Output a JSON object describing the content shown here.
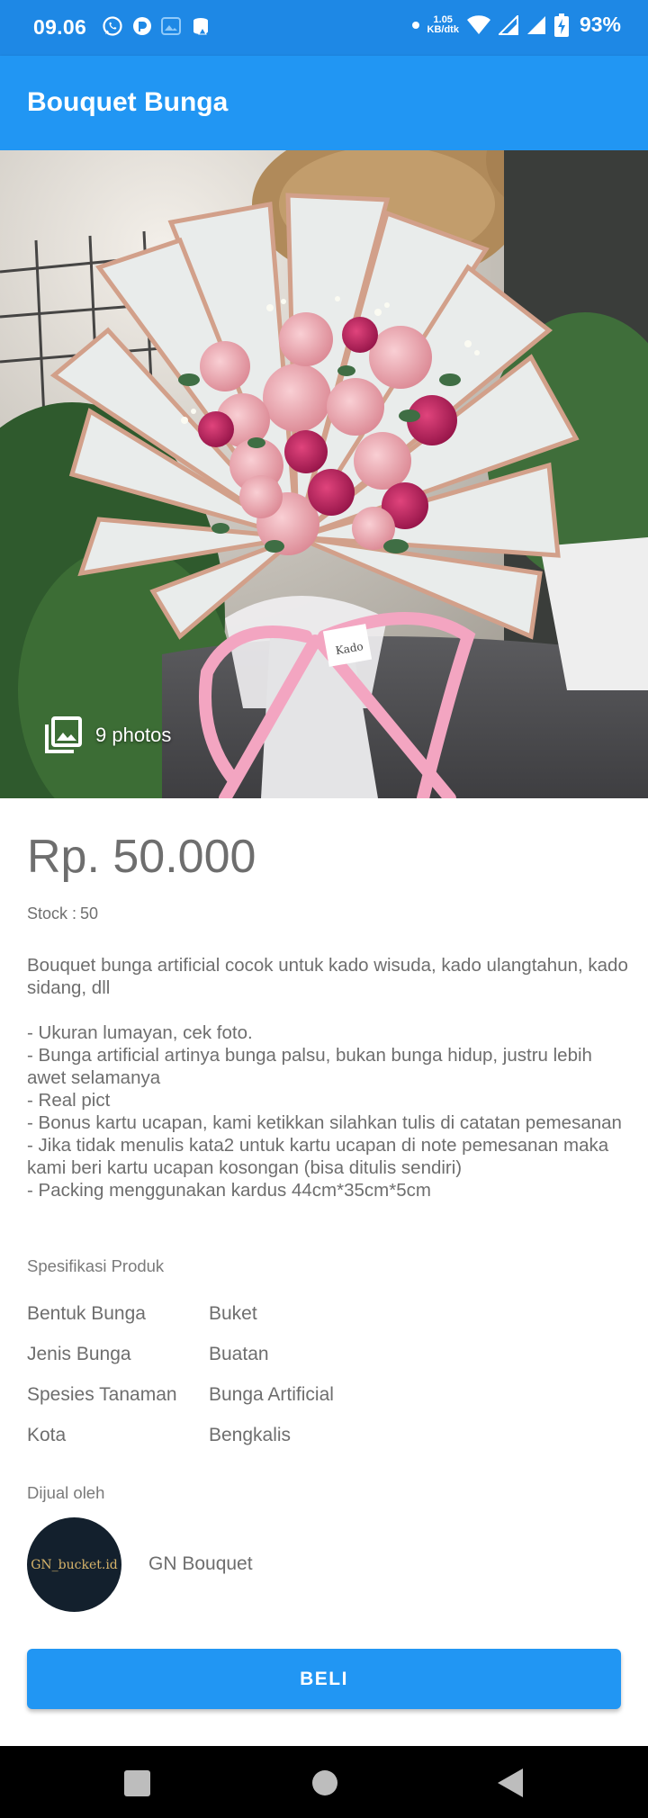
{
  "status_bar": {
    "time": "09.06",
    "net_speed_value": "1.05",
    "net_speed_unit": "KB/dtk",
    "battery": "93%",
    "icons": [
      "whatsapp-icon",
      "app-icon",
      "gallery-icon",
      "cloud-icon",
      "dot-icon",
      "wifi-icon",
      "signal-icon",
      "signal-icon",
      "battery-charging-icon"
    ]
  },
  "app_bar": {
    "title": "Bouquet Bunga"
  },
  "hero": {
    "photos_label": "9 photos",
    "icon": "photo-library-icon"
  },
  "product": {
    "price": "Rp. 50.000",
    "stock_label": "Stock :",
    "stock_value": "50",
    "description": "Bouquet bunga artificial cocok untuk kado wisuda, kado ulangtahun, kado sidang, dll\n\n- Ukuran lumayan, cek foto.\n- Bunga artificial artinya bunga palsu, bukan bunga hidup, justru lebih awet selamanya\n- Real pict\n- Bonus kartu ucapan, kami ketikkan silahkan tulis di catatan pemesanan\n- Jika tidak menulis kata2 untuk kartu ucapan di note pemesanan maka kami beri kartu ucapan kosongan (bisa ditulis sendiri)\n- Packing menggunakan kardus 44cm*35cm*5cm"
  },
  "specs": {
    "heading": "Spesifikasi Produk",
    "rows": [
      {
        "key": "Bentuk Bunga",
        "value": "Buket"
      },
      {
        "key": "Jenis Bunga",
        "value": "Buatan"
      },
      {
        "key": "Spesies Tanaman",
        "value": "Bunga Artificial"
      },
      {
        "key": "Kota",
        "value": "Bengkalis"
      }
    ]
  },
  "seller": {
    "heading": "Dijual oleh",
    "avatar_text": "GN_bucket.id",
    "name": "GN Bouquet"
  },
  "buy_button": {
    "label": "BELI"
  },
  "colors": {
    "primary": "#2196f3",
    "status_bar": "#1e88e5",
    "text": "#6e6e6e"
  }
}
